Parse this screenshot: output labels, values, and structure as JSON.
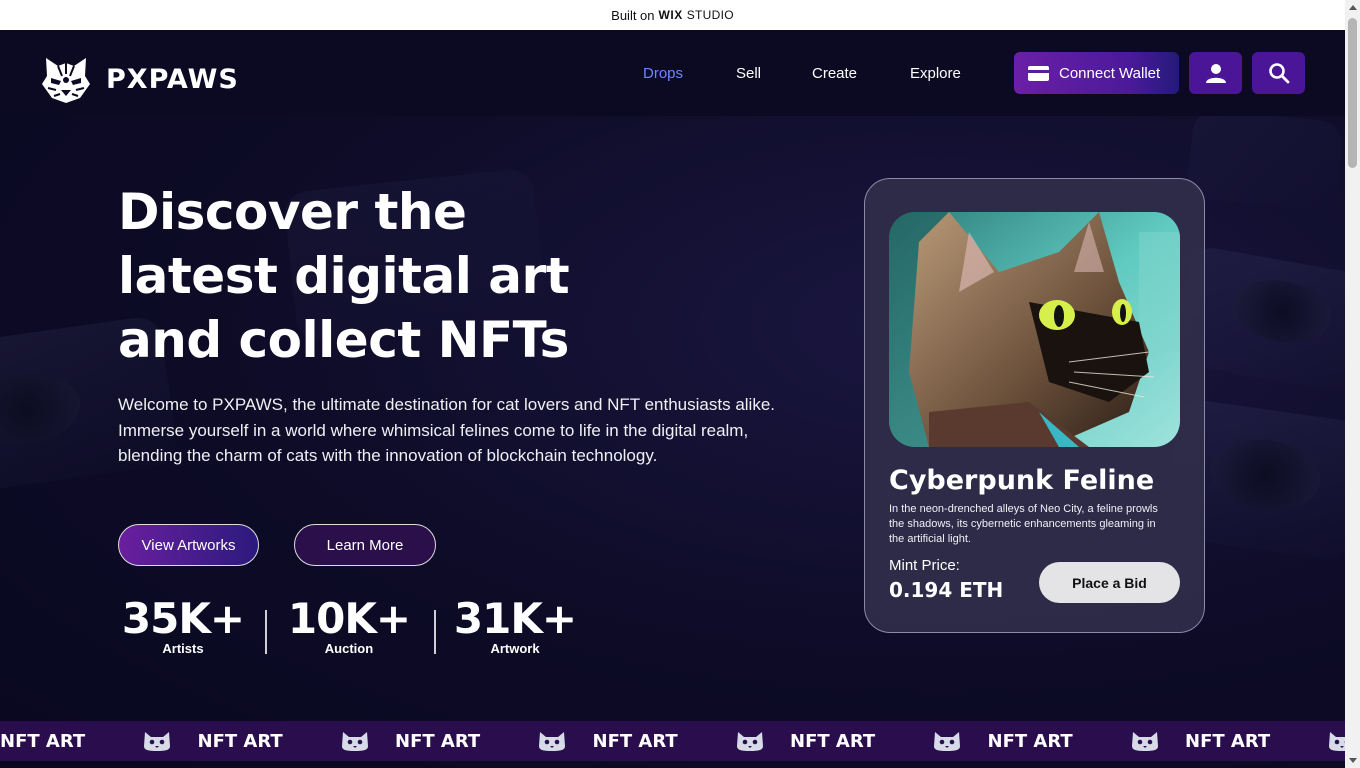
{
  "wix_banner": {
    "prefix": "Built on",
    "brand": "WIX",
    "suffix": "STUDIO"
  },
  "header": {
    "brand": "PXPAWS",
    "nav": [
      {
        "label": "Drops",
        "active": true
      },
      {
        "label": "Sell",
        "active": false
      },
      {
        "label": "Create",
        "active": false
      },
      {
        "label": "Explore",
        "active": false
      }
    ],
    "connect_wallet_label": "Connect Wallet"
  },
  "hero": {
    "title_lines": [
      "Discover the",
      "latest digital art",
      "and collect NFTs"
    ],
    "description": "Welcome to PXPAWS, the ultimate destination for cat lovers and NFT enthusiasts alike. Immerse yourself in a world where whimsical felines come to life in the digital realm, blending the charm of cats with the innovation of blockchain technology.",
    "view_artworks_label": "View Artworks",
    "learn_more_label": "Learn More",
    "stats": [
      {
        "value": "35K+",
        "label": "Artists"
      },
      {
        "value": "10K+",
        "label": "Auction"
      },
      {
        "value": "31K+",
        "label": "Artwork"
      }
    ]
  },
  "featured_card": {
    "title": "Cyberpunk Feline",
    "description": "In the neon-drenched alleys of Neo City, a feline prowls the shadows, its cybernetic enhancements gleaming in the artificial light.",
    "mint_label": "Mint Price:",
    "mint_price": "0.194 ETH",
    "bid_label": "Place a Bid"
  },
  "ticker": {
    "text": "NFT ART"
  },
  "colors": {
    "background": "#0c0a24",
    "nav_active": "#6f86ff",
    "accent_purple": "#4a1596",
    "ticker_bg": "#2a0d4d"
  },
  "icons": [
    "tiger-logo-icon",
    "wallet-icon",
    "user-icon",
    "search-icon",
    "cat-face-icon"
  ]
}
